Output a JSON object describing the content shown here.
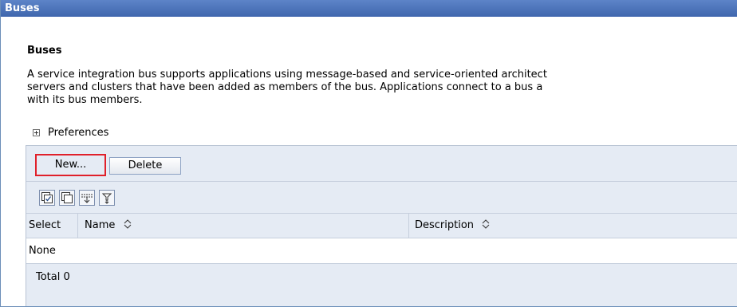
{
  "titlebar": {
    "title": "Buses"
  },
  "content": {
    "heading": "Buses",
    "description_lines": [
      "A service integration bus supports applications using message-based and service-oriented architect",
      "servers and clusters that have been added as members of the bus. Applications connect to a bus a",
      "with its bus members."
    ]
  },
  "preferences": {
    "label": "Preferences",
    "icon": "plus-icon"
  },
  "toolbar": {
    "new_label": "New...",
    "delete_label": "Delete",
    "highlight_color": "#e0202a"
  },
  "icon_tools": [
    {
      "name": "select-all-icon"
    },
    {
      "name": "deselect-all-icon"
    },
    {
      "name": "show-filter-icon"
    },
    {
      "name": "clear-filter-icon"
    }
  ],
  "table": {
    "columns": [
      "Select",
      "Name",
      "Description"
    ],
    "empty_row": "None",
    "total": "Total 0"
  },
  "colors": {
    "titlebar": "#4a73ba",
    "panel": "#e5ebf4",
    "border": "#c6cfdd"
  }
}
